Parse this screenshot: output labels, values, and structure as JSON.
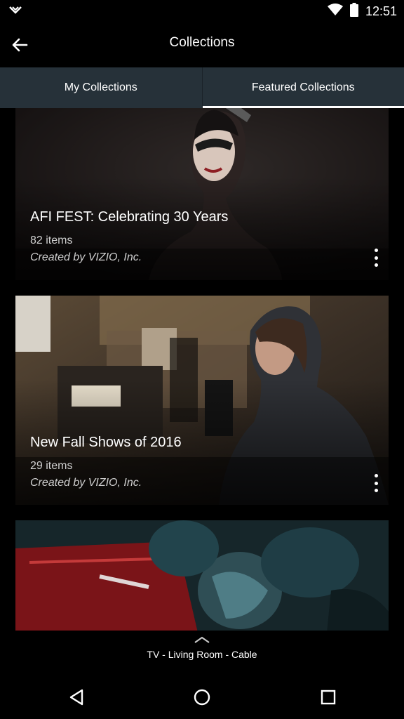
{
  "status_bar": {
    "time": "12:51",
    "icons": [
      "dropdown-icon",
      "wifi-icon",
      "battery-icon"
    ]
  },
  "app_bar": {
    "title": "Collections",
    "back_icon": "arrow-left-icon"
  },
  "tabs": [
    {
      "label": "My Collections",
      "active": false
    },
    {
      "label": "Featured Collections",
      "active": true
    }
  ],
  "collections": [
    {
      "title": "AFI FEST: Celebrating 30 Years",
      "count": "82 items",
      "creator": "Created by VIZIO, Inc."
    },
    {
      "title": "New Fall Shows of 2016",
      "count": "29 items",
      "creator": "Created by VIZIO, Inc."
    },
    {
      "title": "",
      "count": "",
      "creator": ""
    }
  ],
  "device_bar": {
    "label": "TV - Living Room - Cable",
    "icon": "chevron-up-icon"
  },
  "nav_bar": {
    "icons": [
      "back-triangle-icon",
      "home-circle-icon",
      "recents-square-icon"
    ]
  },
  "colors": {
    "tab_background": "#263139",
    "background": "#000000",
    "text_secondary": "#cfcfcf"
  }
}
